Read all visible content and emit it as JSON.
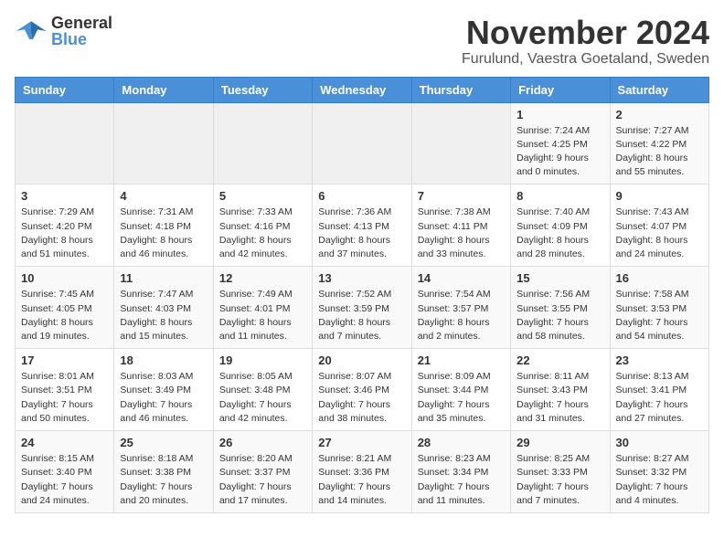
{
  "header": {
    "logo_general": "General",
    "logo_blue": "Blue",
    "month": "November 2024",
    "location": "Furulund, Vaestra Goetaland, Sweden"
  },
  "days_of_week": [
    "Sunday",
    "Monday",
    "Tuesday",
    "Wednesday",
    "Thursday",
    "Friday",
    "Saturday"
  ],
  "weeks": [
    {
      "cells": [
        {
          "day": "",
          "info": ""
        },
        {
          "day": "",
          "info": ""
        },
        {
          "day": "",
          "info": ""
        },
        {
          "day": "",
          "info": ""
        },
        {
          "day": "",
          "info": ""
        },
        {
          "day": "1",
          "info": "Sunrise: 7:24 AM\nSunset: 4:25 PM\nDaylight: 9 hours\nand 0 minutes."
        },
        {
          "day": "2",
          "info": "Sunrise: 7:27 AM\nSunset: 4:22 PM\nDaylight: 8 hours\nand 55 minutes."
        }
      ]
    },
    {
      "cells": [
        {
          "day": "3",
          "info": "Sunrise: 7:29 AM\nSunset: 4:20 PM\nDaylight: 8 hours\nand 51 minutes."
        },
        {
          "day": "4",
          "info": "Sunrise: 7:31 AM\nSunset: 4:18 PM\nDaylight: 8 hours\nand 46 minutes."
        },
        {
          "day": "5",
          "info": "Sunrise: 7:33 AM\nSunset: 4:16 PM\nDaylight: 8 hours\nand 42 minutes."
        },
        {
          "day": "6",
          "info": "Sunrise: 7:36 AM\nSunset: 4:13 PM\nDaylight: 8 hours\nand 37 minutes."
        },
        {
          "day": "7",
          "info": "Sunrise: 7:38 AM\nSunset: 4:11 PM\nDaylight: 8 hours\nand 33 minutes."
        },
        {
          "day": "8",
          "info": "Sunrise: 7:40 AM\nSunset: 4:09 PM\nDaylight: 8 hours\nand 28 minutes."
        },
        {
          "day": "9",
          "info": "Sunrise: 7:43 AM\nSunset: 4:07 PM\nDaylight: 8 hours\nand 24 minutes."
        }
      ]
    },
    {
      "cells": [
        {
          "day": "10",
          "info": "Sunrise: 7:45 AM\nSunset: 4:05 PM\nDaylight: 8 hours\nand 19 minutes."
        },
        {
          "day": "11",
          "info": "Sunrise: 7:47 AM\nSunset: 4:03 PM\nDaylight: 8 hours\nand 15 minutes."
        },
        {
          "day": "12",
          "info": "Sunrise: 7:49 AM\nSunset: 4:01 PM\nDaylight: 8 hours\nand 11 minutes."
        },
        {
          "day": "13",
          "info": "Sunrise: 7:52 AM\nSunset: 3:59 PM\nDaylight: 8 hours\nand 7 minutes."
        },
        {
          "day": "14",
          "info": "Sunrise: 7:54 AM\nSunset: 3:57 PM\nDaylight: 8 hours\nand 2 minutes."
        },
        {
          "day": "15",
          "info": "Sunrise: 7:56 AM\nSunset: 3:55 PM\nDaylight: 7 hours\nand 58 minutes."
        },
        {
          "day": "16",
          "info": "Sunrise: 7:58 AM\nSunset: 3:53 PM\nDaylight: 7 hours\nand 54 minutes."
        }
      ]
    },
    {
      "cells": [
        {
          "day": "17",
          "info": "Sunrise: 8:01 AM\nSunset: 3:51 PM\nDaylight: 7 hours\nand 50 minutes."
        },
        {
          "day": "18",
          "info": "Sunrise: 8:03 AM\nSunset: 3:49 PM\nDaylight: 7 hours\nand 46 minutes."
        },
        {
          "day": "19",
          "info": "Sunrise: 8:05 AM\nSunset: 3:48 PM\nDaylight: 7 hours\nand 42 minutes."
        },
        {
          "day": "20",
          "info": "Sunrise: 8:07 AM\nSunset: 3:46 PM\nDaylight: 7 hours\nand 38 minutes."
        },
        {
          "day": "21",
          "info": "Sunrise: 8:09 AM\nSunset: 3:44 PM\nDaylight: 7 hours\nand 35 minutes."
        },
        {
          "day": "22",
          "info": "Sunrise: 8:11 AM\nSunset: 3:43 PM\nDaylight: 7 hours\nand 31 minutes."
        },
        {
          "day": "23",
          "info": "Sunrise: 8:13 AM\nSunset: 3:41 PM\nDaylight: 7 hours\nand 27 minutes."
        }
      ]
    },
    {
      "cells": [
        {
          "day": "24",
          "info": "Sunrise: 8:15 AM\nSunset: 3:40 PM\nDaylight: 7 hours\nand 24 minutes."
        },
        {
          "day": "25",
          "info": "Sunrise: 8:18 AM\nSunset: 3:38 PM\nDaylight: 7 hours\nand 20 minutes."
        },
        {
          "day": "26",
          "info": "Sunrise: 8:20 AM\nSunset: 3:37 PM\nDaylight: 7 hours\nand 17 minutes."
        },
        {
          "day": "27",
          "info": "Sunrise: 8:21 AM\nSunset: 3:36 PM\nDaylight: 7 hours\nand 14 minutes."
        },
        {
          "day": "28",
          "info": "Sunrise: 8:23 AM\nSunset: 3:34 PM\nDaylight: 7 hours\nand 11 minutes."
        },
        {
          "day": "29",
          "info": "Sunrise: 8:25 AM\nSunset: 3:33 PM\nDaylight: 7 hours\nand 7 minutes."
        },
        {
          "day": "30",
          "info": "Sunrise: 8:27 AM\nSunset: 3:32 PM\nDaylight: 7 hours\nand 4 minutes."
        }
      ]
    }
  ]
}
